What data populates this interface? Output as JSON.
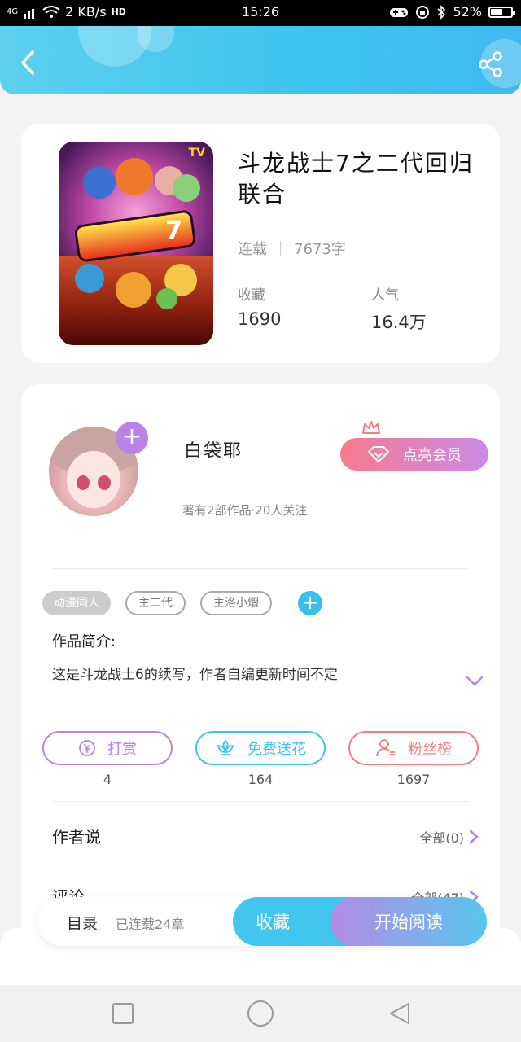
{
  "status_bar": {
    "network": "4G",
    "speed": "2 KB/s",
    "hd": "HD",
    "time": "15:26",
    "battery": "52%",
    "battery_level": 0.52
  },
  "header": {
    "back_icon": "chevron-left-icon",
    "share_icon": "share-icon"
  },
  "book": {
    "title": "斗龙战士7之二代回归联合",
    "status": "连载",
    "word_count": "7673字",
    "favorites_label": "收藏",
    "favorites_value": "1690",
    "popularity_label": "人气",
    "popularity_value": "16.4万",
    "cover_tag": "TV",
    "cover_number": "7"
  },
  "author": {
    "name": "白袋耶",
    "info": "著有2部作品·20人关注",
    "follow_plus": "+",
    "vip_button": "点亮会员"
  },
  "tags": [
    {
      "label": "动漫同人",
      "style": "filled"
    },
    {
      "label": "主二代",
      "style": "outline"
    },
    {
      "label": "主洛小熠",
      "style": "outline"
    }
  ],
  "tag_add": "+",
  "intro": {
    "label": "作品简介:",
    "text": "这是斗龙战士6的续写，作者自编更新时间不定"
  },
  "actions": [
    {
      "label": "打赏",
      "count": "4",
      "icon": "yen-coin-icon",
      "color": "#b983e6"
    },
    {
      "label": "免费送花",
      "count": "164",
      "icon": "flower-icon",
      "color": "#41c2ef"
    },
    {
      "label": "粉丝榜",
      "count": "1697",
      "icon": "user-icon",
      "color": "#f07f83"
    }
  ],
  "rows": {
    "author_says_label": "作者说",
    "author_says_right": "全部(0)",
    "comments_label": "评论",
    "comments_right": "全部(47)"
  },
  "bottom_bar": {
    "menu": "目录",
    "serial": "已连载24章",
    "favorite": "收藏",
    "read": "开始阅读"
  },
  "colors": {
    "accent_blue": "#42c6ef",
    "accent_purple": "#b983e6",
    "accent_pink": "#f77b8e"
  }
}
